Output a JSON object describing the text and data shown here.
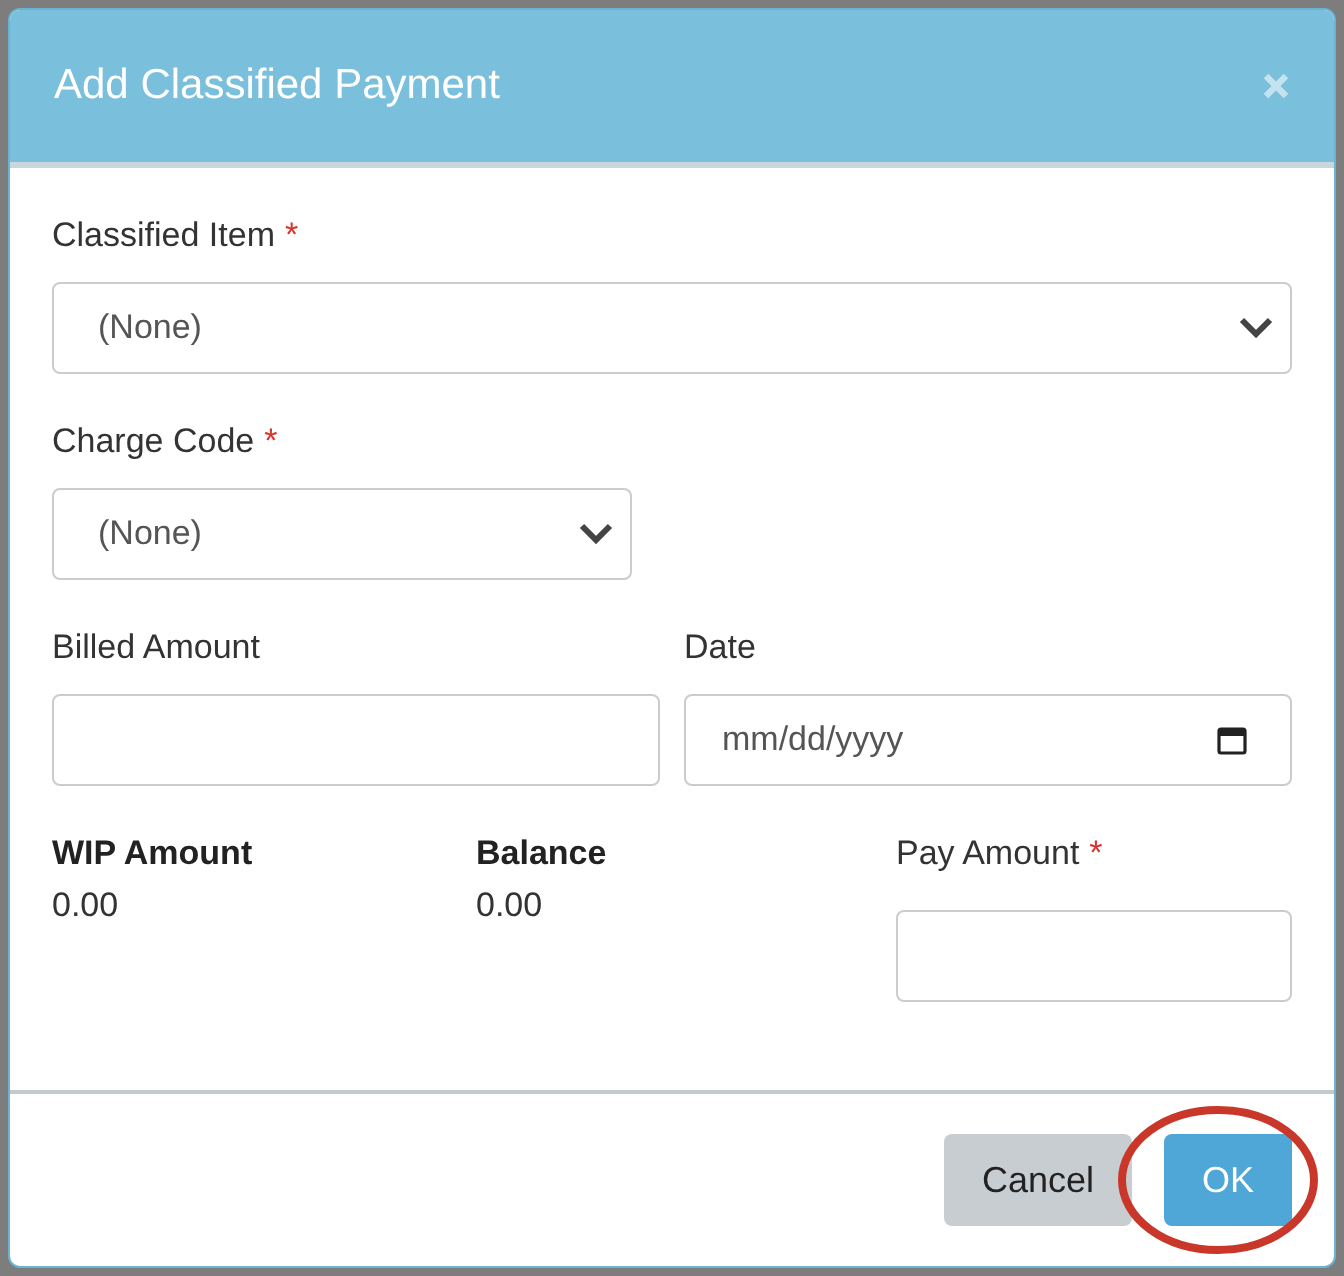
{
  "dialog": {
    "title": "Add Classified Payment"
  },
  "fields": [
    {
      "kind": "select",
      "label": "Classified Item",
      "required_mark": "*",
      "value": "(None)",
      "full_width": true
    },
    {
      "kind": "select",
      "label": "Charge Code",
      "required_mark": "*",
      "value": "(None)",
      "full_width": false
    }
  ],
  "row_fields": [
    {
      "kind": "text",
      "label": "Billed Amount"
    },
    {
      "kind": "date",
      "label": "Date",
      "placeholder": "mm/dd/yyyy"
    }
  ],
  "summary": [
    {
      "kind": "readout",
      "label": "WIP Amount",
      "value": "0.00"
    },
    {
      "kind": "readout",
      "label": "Balance",
      "value": "0.00"
    },
    {
      "kind": "input",
      "label": "Pay Amount",
      "required_mark": "*"
    }
  ],
  "buttons": [
    {
      "label": "Cancel",
      "kind": "secondary",
      "highlighted": false
    },
    {
      "label": "OK",
      "kind": "primary",
      "highlighted": true
    }
  ]
}
